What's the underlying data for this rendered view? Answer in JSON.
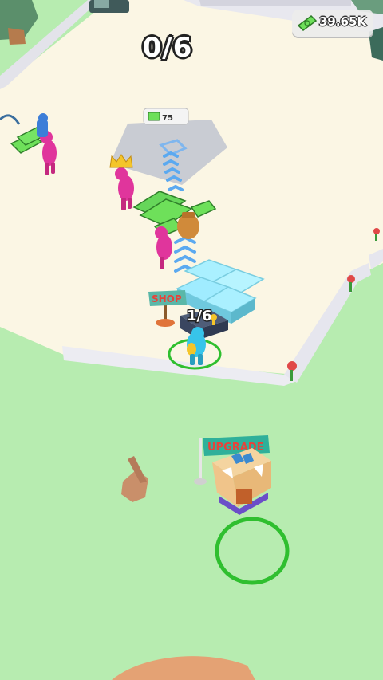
{
  "hud": {
    "collected_counter": "0/6",
    "money": "39.65K"
  },
  "world": {
    "shop_sign": "SHOP",
    "unlock_cost": "75",
    "player_carry": "1/6",
    "upgrade_sign": "UPGRADE"
  },
  "colors": {
    "grass": "#b7ecb0",
    "floor": "#fbf6e4",
    "wall": "#ececf2",
    "cash": "#6ee05a",
    "customer": "#e0359c",
    "player": "#37c4ea",
    "ice_block": "#aaf0ff",
    "ring": "#2fbf2f"
  },
  "icons": [
    "cash-icon",
    "crown-icon",
    "cash-stack-icon"
  ]
}
